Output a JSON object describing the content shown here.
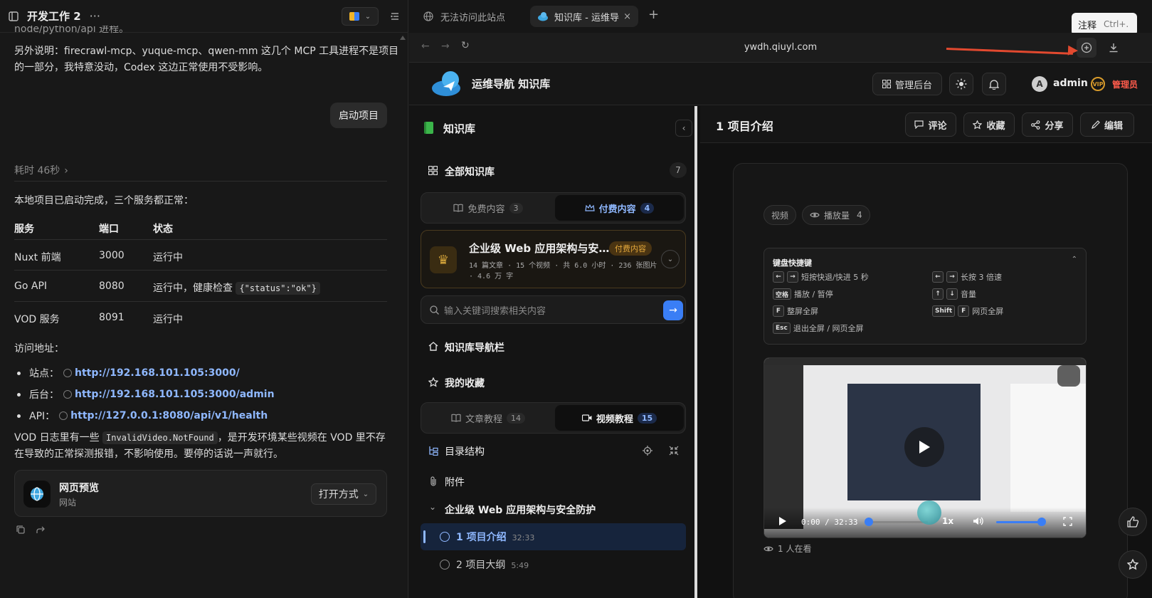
{
  "left": {
    "title": "开发工作 2",
    "more": "···",
    "top_partial": "node/python/api 进程。",
    "note_line1": "另外说明：firecrawl-mcp、yuque-mcp、qwen-mm 这几个 MCP 工具进程不是项目",
    "note_line2": "的一部分，我特意没动，Codex 这边正常使用不受影响。",
    "user_bubble": "启动项目",
    "elapsed": "耗时 46秒",
    "status_intro": "本地项目已启动完成，三个服务都正常：",
    "table": {
      "headers": [
        "服务",
        "端口",
        "状态"
      ],
      "rows": [
        {
          "service": "Nuxt 前端",
          "port": "3000",
          "status": "运行中",
          "code": ""
        },
        {
          "service": "Go API",
          "port": "8080",
          "status": "运行中，健康检查",
          "code": "{\"status\":\"ok\"}"
        },
        {
          "service": "VOD 服务",
          "port": "8091",
          "status": "运行中",
          "code": ""
        }
      ]
    },
    "access_label": "访问地址：",
    "links": [
      {
        "label": "站点：",
        "url": "http://192.168.101.105:3000/"
      },
      {
        "label": "后台：",
        "url": "http://192.168.101.105:3000/admin"
      },
      {
        "label": "API：",
        "url": "http://127.0.0.1:8080/api/v1/health"
      }
    ],
    "vod_line1_a": "VOD 日志里有一些",
    "vod_code": "InvalidVideo.NotFound",
    "vod_line1_b": "，是开发环境某些视频在 VOD 里不存",
    "vod_line2": "在导致的正常探测报错，不影响使用。要停的话说一声就行。",
    "card": {
      "title": "网页预览",
      "subtitle": "网站",
      "open": "打开方式"
    }
  },
  "browser": {
    "tabs": [
      {
        "label": "无法访问此站点"
      },
      {
        "label": "知识库 - 运维导"
      }
    ],
    "tooltip": {
      "label": "注释",
      "shortcut": "Ctrl+."
    },
    "url": "ywdh.qiuyl.com"
  },
  "site": {
    "brand": "运维导航 知识库",
    "admin_btn": "管理后台",
    "avatar_letter": "A",
    "username": "admin",
    "vip": "VIP",
    "role": "管理员",
    "kb": {
      "title": "知识库",
      "all_label": "全部知识库",
      "all_count": "7",
      "tabs1": [
        {
          "label": "免费内容",
          "count": "3"
        },
        {
          "label": "付费内容",
          "count": "4"
        }
      ],
      "course": {
        "title": "企业级 Web 应用架构与安…",
        "badge": "付费内容",
        "meta": "14 篇文章 · 15 个视频 · 共 6.0 小时 · 236 张图片 · 4.6 万 字"
      },
      "search_placeholder": "输入关键词搜索相关内容",
      "nav_label": "知识库导航栏",
      "fav_label": "我的收藏",
      "tabs2": [
        {
          "label": "文章教程",
          "count": "14"
        },
        {
          "label": "视频教程",
          "count": "15"
        }
      ],
      "toc_label": "目录结构",
      "attach_label": "附件",
      "section": "企业级 Web 应用架构与安全防护",
      "lessons": [
        {
          "title": "1 项目介绍",
          "duration": "32:33"
        },
        {
          "title": "2 项目大纲",
          "duration": "5:49"
        }
      ]
    },
    "doc": {
      "title": "1 项目介绍",
      "actions": [
        "评论",
        "收藏",
        "分享",
        "编辑"
      ],
      "tag_video": "视频",
      "tag_views": "播放量",
      "views": "4",
      "shortcuts_title": "键盘快捷键",
      "shortcuts": [
        {
          "keys": [
            "←",
            "→"
          ],
          "desc": "短按快退/快进 5 秒"
        },
        {
          "keys": [
            "←",
            "→"
          ],
          "desc": "长按 3 倍速"
        },
        {
          "keys": [
            "空格"
          ],
          "desc": "播放 / 暂停"
        },
        {
          "keys": [
            "↑",
            "↓"
          ],
          "desc": "音量"
        },
        {
          "keys": [
            "F"
          ],
          "desc": "整屏全屏"
        },
        {
          "keys": [
            "Shift",
            "F"
          ],
          "desc": "网页全屏"
        },
        {
          "keys": [
            "Esc"
          ],
          "desc": "退出全屏 / 网页全屏"
        }
      ],
      "player": {
        "time": "0:00 / 32:33",
        "rate": "1x"
      },
      "watching": "1 人在看"
    }
  }
}
